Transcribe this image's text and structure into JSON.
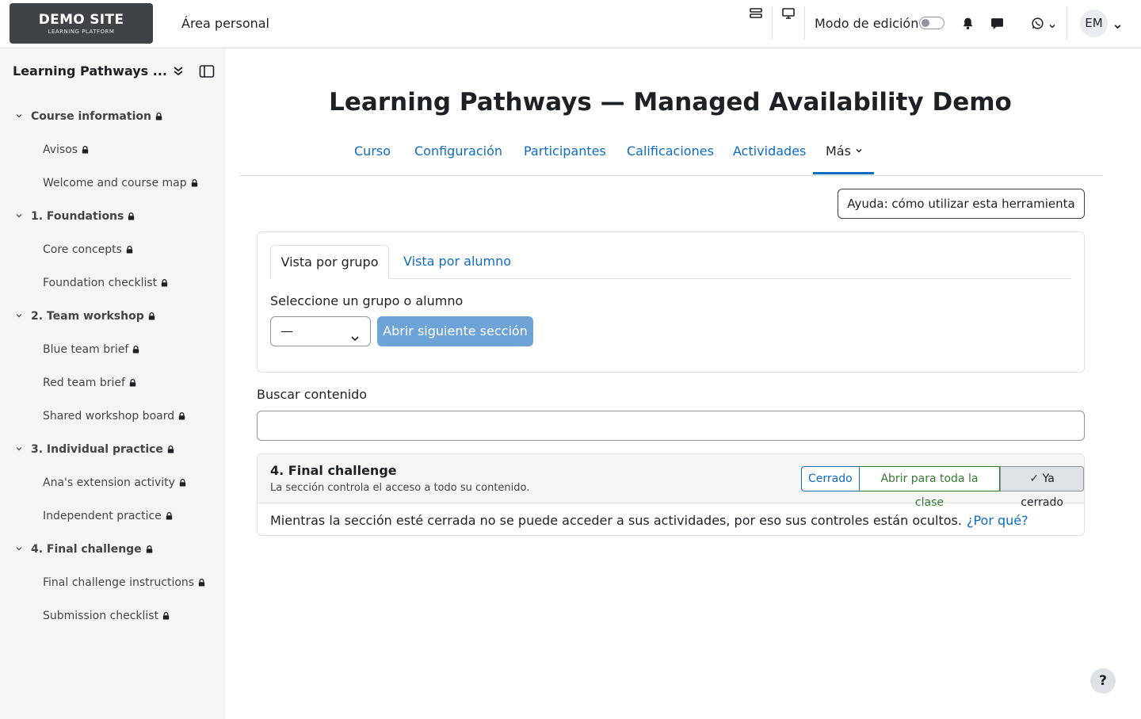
{
  "header": {
    "logo_title": "DEMO SITE",
    "logo_subtitle": "LEARNING PLATFORM",
    "home_link": "Área personal",
    "edit_mode_label": "Modo de edición",
    "edit_mode_on": false,
    "user_initials": "EM"
  },
  "drawer": {
    "title": "Learning Pathways ...",
    "items": [
      {
        "type": "section",
        "label": "Course information"
      },
      {
        "type": "activity",
        "label": "Avisos"
      },
      {
        "type": "activity",
        "label": "Welcome and course map"
      },
      {
        "type": "section",
        "label": "1. Foundations"
      },
      {
        "type": "activity",
        "label": "Core concepts"
      },
      {
        "type": "activity",
        "label": "Foundation checklist"
      },
      {
        "type": "section",
        "label": "2. Team workshop"
      },
      {
        "type": "activity",
        "label": "Blue team brief"
      },
      {
        "type": "activity",
        "label": "Red team brief"
      },
      {
        "type": "activity",
        "label": "Shared workshop board"
      },
      {
        "type": "section",
        "label": "3. Individual practice"
      },
      {
        "type": "activity",
        "label": "Ana's extension activity"
      },
      {
        "type": "activity",
        "label": "Independent practice"
      },
      {
        "type": "section",
        "label": "4. Final challenge"
      },
      {
        "type": "activity",
        "label": "Final challenge instructions"
      },
      {
        "type": "activity",
        "label": "Submission checklist"
      }
    ]
  },
  "main": {
    "title": "Learning Pathways — Managed Availability Demo",
    "tabs": [
      {
        "label": "Curso"
      },
      {
        "label": "Configuración"
      },
      {
        "label": "Participantes"
      },
      {
        "label": "Calificaciones"
      },
      {
        "label": "Actividades"
      },
      {
        "label": "Más"
      }
    ],
    "active_tab": "Más",
    "help_button": "Ayuda: cómo utilizar esta herramienta",
    "view_tabs": {
      "group": "Vista por grupo",
      "student": "Vista por alumno"
    },
    "select_label": "Seleccione un grupo o alumno",
    "select_value": "—",
    "open_next_button": "Abrir siguiente sección",
    "search_label": "Buscar contenido",
    "search_value": "",
    "section": {
      "name": "4. Final challenge",
      "description": "La sección controla el acceso a todo su contenido.",
      "btn_closed": "Cerrado",
      "btn_open_all": "Abrir para toda la clase",
      "btn_already_closed": "✓ Ya cerrado",
      "body": "Mientras la sección esté cerrada no se puede acceder a sus actividades, por eso sus controles están ocultos.",
      "why_link": "¿Por qué?"
    },
    "help_circle": "?"
  }
}
